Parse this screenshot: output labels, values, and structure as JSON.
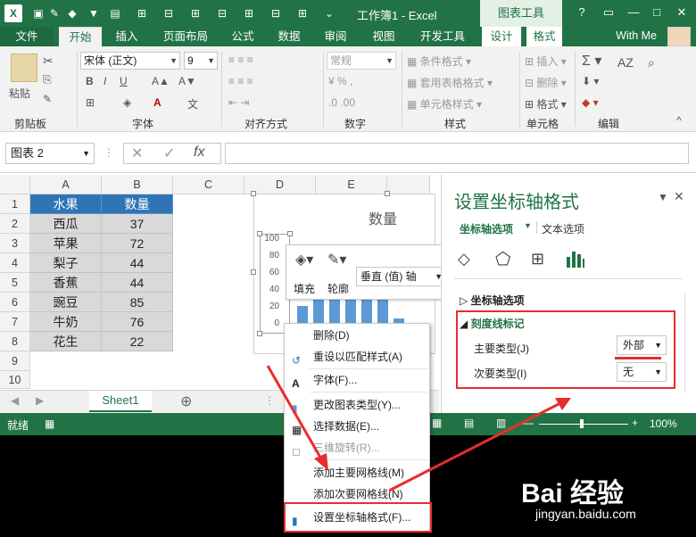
{
  "window": {
    "doc_title": "工作簿1 - Excel",
    "context_group": "图表工具",
    "help": "?",
    "user": "With Me"
  },
  "tabs": {
    "file": "文件",
    "home": "开始",
    "insert": "插入",
    "page_layout": "页面布局",
    "formulas": "公式",
    "data": "数据",
    "review": "审阅",
    "view": "视图",
    "developer": "开发工具",
    "design": "设计",
    "format": "格式"
  },
  "ribbon": {
    "clipboard": {
      "paste": "粘贴",
      "label": "剪贴板"
    },
    "font": {
      "name": "宋体 (正文)",
      "size": "9",
      "bold": "B",
      "italic": "I",
      "underline": "U",
      "label": "字体"
    },
    "alignment": {
      "label": "对齐方式"
    },
    "number": {
      "format": "常规",
      "label": "数字"
    },
    "styles": {
      "conditional": "条件格式",
      "table": "套用表格格式",
      "cell_styles": "单元格样式",
      "label": "样式"
    },
    "cells": {
      "insert": "插入",
      "delete": "删除",
      "format": "格式",
      "label": "单元格"
    },
    "editing": {
      "label": "编辑"
    }
  },
  "formula_bar": {
    "name_box": "图表 2",
    "fx": "fx"
  },
  "columns": [
    "A",
    "B",
    "C",
    "D",
    "E"
  ],
  "rows": [
    "1",
    "2",
    "3",
    "4",
    "5",
    "6",
    "7",
    "8",
    "9",
    "10"
  ],
  "table": {
    "headers": [
      "水果",
      "数量"
    ],
    "rows": [
      [
        "西瓜",
        "37"
      ],
      [
        "苹果",
        "72"
      ],
      [
        "梨子",
        "44"
      ],
      [
        "香蕉",
        "44"
      ],
      [
        "豌豆",
        "85"
      ],
      [
        "牛奶",
        "76"
      ],
      [
        "花生",
        "22"
      ]
    ]
  },
  "chart": {
    "title": "数量",
    "y_ticks": [
      "100",
      "80",
      "60",
      "40",
      "20",
      "0"
    ],
    "values": [
      37,
      72,
      44,
      44,
      85,
      76,
      22
    ],
    "ymax": 100,
    "bar_color": "#5b9bd5"
  },
  "mini_toolbar": {
    "fill": "填充",
    "outline": "轮廓",
    "element": "垂直 (值) 轴"
  },
  "sheet": {
    "tab": "Sheet1"
  },
  "status": {
    "ready": "就绪",
    "zoom": "100%"
  },
  "pane": {
    "title": "设置坐标轴格式",
    "tab_axis": "坐标轴选项",
    "tab_text": "文本选项",
    "section_axis": "坐标轴选项",
    "section_ticks": "刻度线标记",
    "major_label": "主要类型(J)",
    "major_value": "外部",
    "minor_label": "次要类型(I)",
    "minor_value": "无"
  },
  "context_menu": [
    {
      "label": "删除(D)",
      "enabled": true
    },
    {
      "label": "重设以匹配样式(A)",
      "enabled": true
    },
    {
      "label": "字体(F)...",
      "enabled": true
    },
    {
      "label": "更改图表类型(Y)...",
      "enabled": true
    },
    {
      "label": "选择数据(E)...",
      "enabled": true
    },
    {
      "label": "三维旋转(R)...",
      "enabled": false
    },
    {
      "label": "添加主要网格线(M)",
      "enabled": true
    },
    {
      "label": "添加次要网格线(N)",
      "enabled": true
    },
    {
      "label": "设置坐标轴格式(F)...",
      "enabled": true
    }
  ],
  "watermark": {
    "brand": "Bai 经验",
    "url": "jingyan.baidu.com"
  }
}
